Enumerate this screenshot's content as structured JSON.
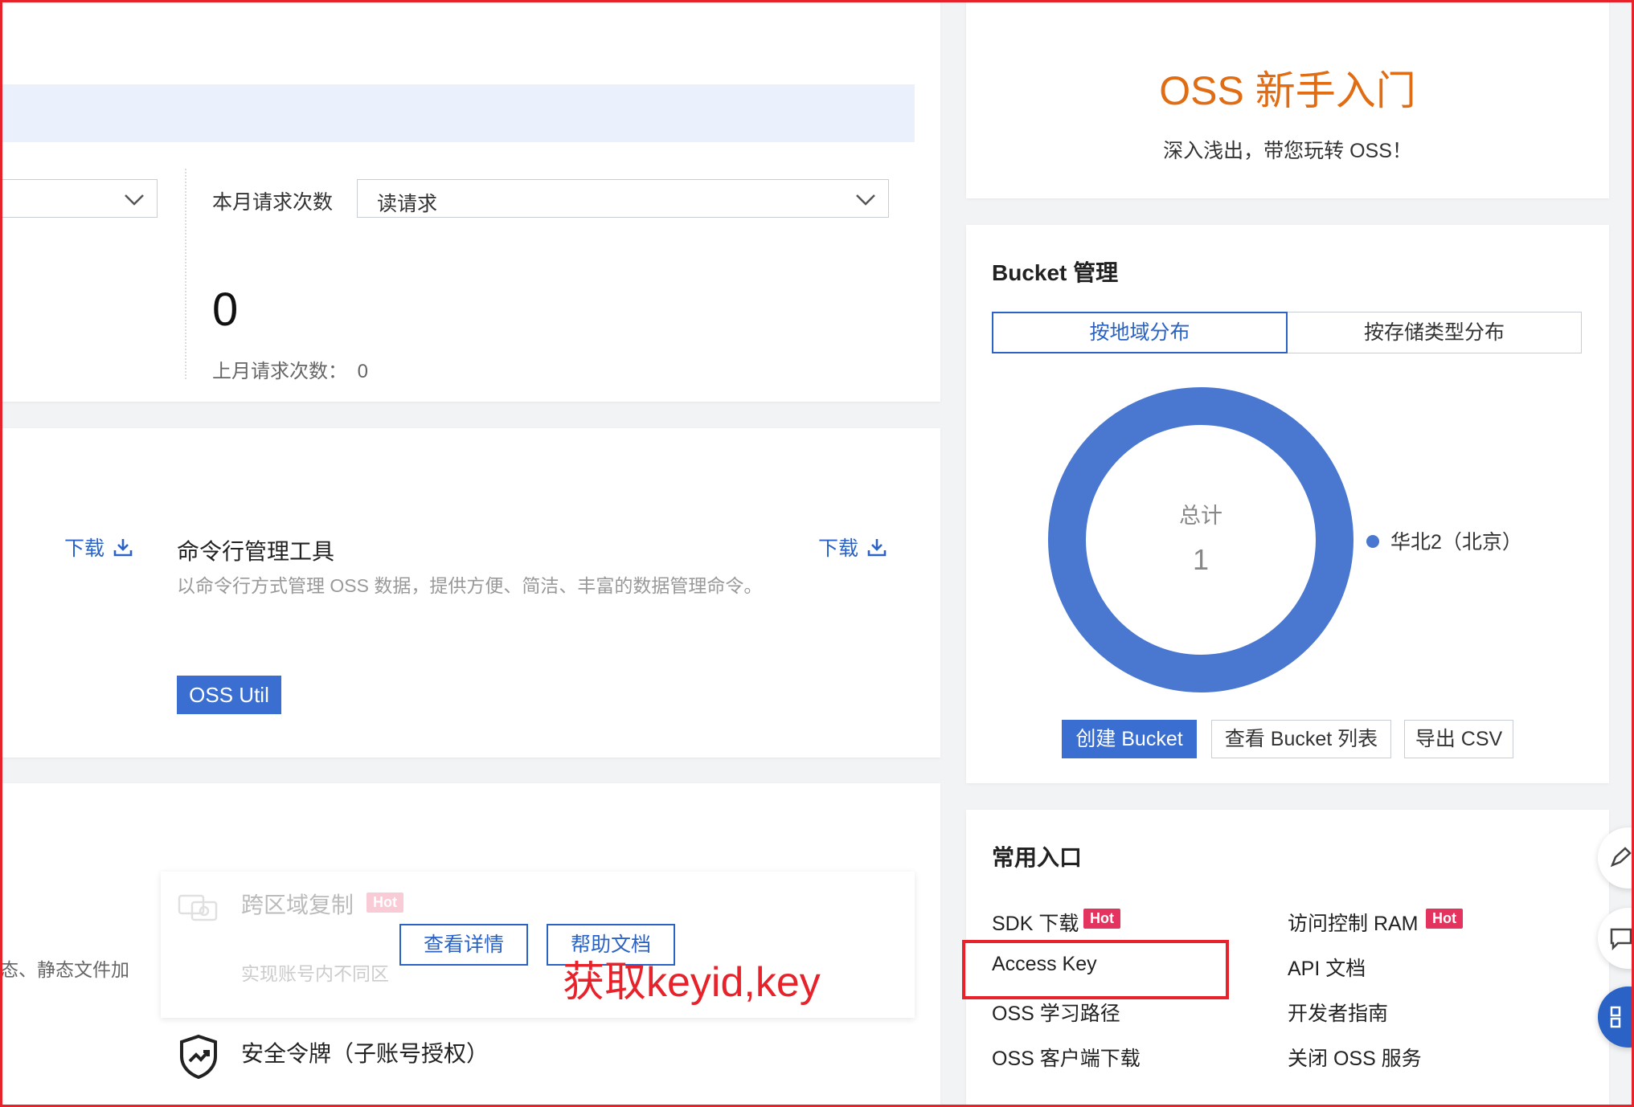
{
  "stats": {
    "request_label": "本月请求次数",
    "request_type_selected": "读请求",
    "request_count": "0",
    "last_month_label": "上月请求次数：",
    "last_month_value": "0"
  },
  "tools": {
    "download_label": "下载",
    "cli_title": "命令行管理工具",
    "cli_desc": "以命令行方式管理 OSS 数据，提供方便、简洁、丰富的数据管理命令。",
    "ossutil_button": "OSS Util"
  },
  "features": {
    "left_partial_text": "态、静态文件加",
    "crr_title": "跨区域复制",
    "crr_hot": "Hot",
    "crr_desc": "实现账号内不同区",
    "details_button": "查看详情",
    "help_button": "帮助文档",
    "token_title": "安全令牌（子账号授权）"
  },
  "annotation": {
    "text": "获取keyid,key",
    "color": "#e8222a"
  },
  "intro": {
    "title": "OSS 新手入门",
    "subtitle": "深入浅出，带您玩转 OSS！"
  },
  "bucket": {
    "title": "Bucket 管理",
    "tabs": [
      "按地域分布",
      "按存储类型分布"
    ],
    "active_tab": 0,
    "total_label": "总计",
    "total_value": "1",
    "create_button": "创建 Bucket",
    "list_button": "查看 Bucket 列表",
    "export_button": "导出 CSV"
  },
  "chart_data": {
    "type": "pie",
    "categories": [
      "华北2（北京）"
    ],
    "values": [
      1
    ],
    "colors": [
      "#4a78d1"
    ],
    "legend_position": "right"
  },
  "entries": {
    "title": "常用入口",
    "items": [
      {
        "label": "SDK 下载",
        "hot": "Hot"
      },
      {
        "label": "访问控制 RAM",
        "hot": "Hot"
      },
      {
        "label": "Access Key",
        "hot": ""
      },
      {
        "label": "API 文档",
        "hot": ""
      },
      {
        "label": "OSS 学习路径",
        "hot": ""
      },
      {
        "label": "开发者指南",
        "hot": ""
      },
      {
        "label": "OSS 客户端下载",
        "hot": ""
      },
      {
        "label": "关闭 OSS 服务",
        "hot": ""
      }
    ]
  },
  "colors": {
    "accent": "#2a63c5",
    "brand_orange": "#e06c13",
    "hot_badge": "#e5335f",
    "highlight_box": "#e8222a"
  }
}
